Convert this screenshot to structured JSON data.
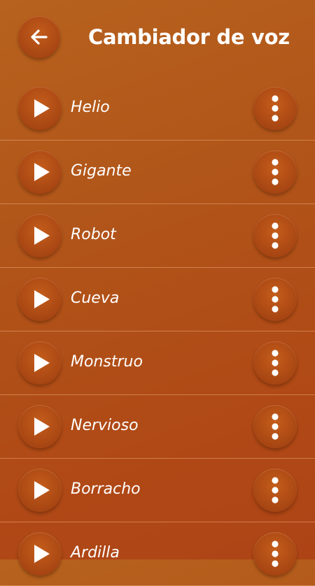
{
  "header": {
    "title": "Cambiador de voz",
    "back_icon": "arrow-left-icon"
  },
  "effects": [
    {
      "label": "Helio",
      "slug": "helio"
    },
    {
      "label": "Gigante",
      "slug": "gigante"
    },
    {
      "label": "Robot",
      "slug": "robot"
    },
    {
      "label": "Cueva",
      "slug": "cueva"
    },
    {
      "label": "Monstruo",
      "slug": "monstruo"
    },
    {
      "label": "Nervioso",
      "slug": "nervioso"
    },
    {
      "label": "Borracho",
      "slug": "borracho"
    },
    {
      "label": "Ardilla",
      "slug": "ardilla"
    }
  ],
  "icons": {
    "play": "play-icon",
    "menu": "more-vertical-icon"
  },
  "colors": {
    "background_top": "#b7621e",
    "background_bottom": "#ae4416",
    "button": "#a84613",
    "divider": "#e8a878",
    "text": "#ffffff"
  }
}
